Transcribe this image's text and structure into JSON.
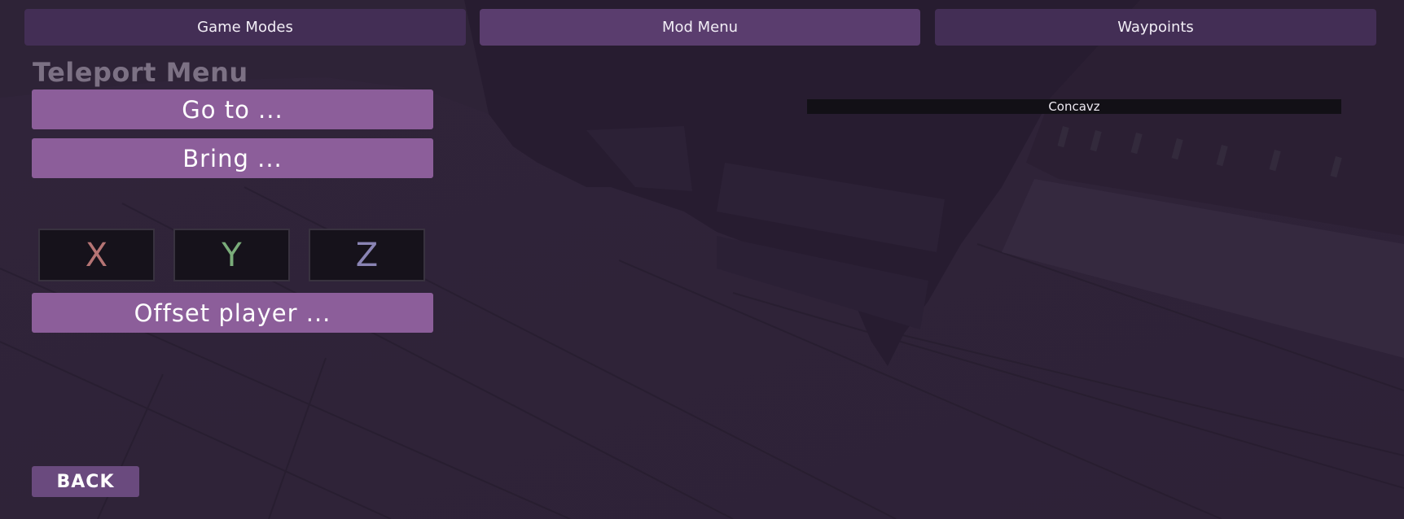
{
  "tabs": [
    {
      "label": "Game Modes",
      "active": false
    },
    {
      "label": "Mod Menu",
      "active": true
    },
    {
      "label": "Waypoints",
      "active": false
    }
  ],
  "section": {
    "title": "Teleport Menu"
  },
  "actions": {
    "goto_label": "Go to ...",
    "bring_label": "Bring ...",
    "offset_label": "Offset player ..."
  },
  "coordinates": {
    "x_placeholder": "X",
    "y_placeholder": "Y",
    "z_placeholder": "Z",
    "x_color": "#b57474",
    "y_color": "#7aac7a",
    "z_color": "#8a84b4"
  },
  "players": [
    {
      "name": "Concavz"
    }
  ],
  "footer": {
    "back_label": "BACK"
  },
  "colors": {
    "tab_inactive": "#432e55",
    "tab_active": "#5a3d6e",
    "action_button": "#8c5e9a",
    "back_button": "#6a4a7e"
  }
}
